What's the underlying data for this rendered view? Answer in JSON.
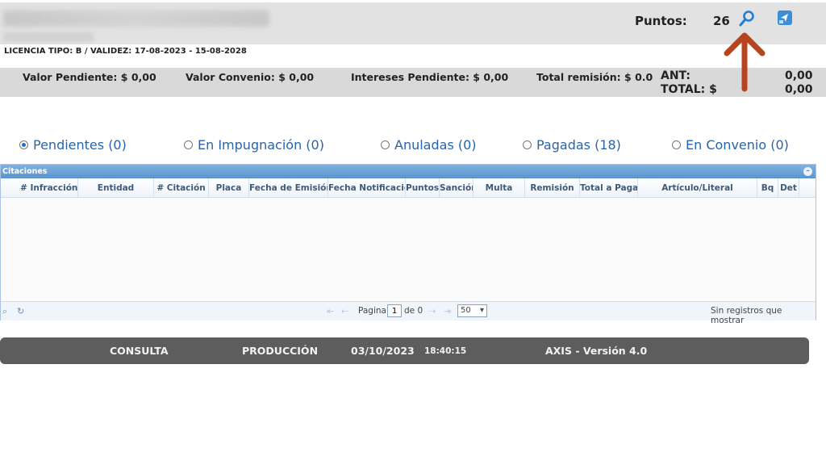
{
  "header": {
    "puntos_label": "Puntos:",
    "puntos_value": "26",
    "licencia": "LICENCIA TIPO: B   / VALIDEZ: 17-08-2023 - 15-08-2028"
  },
  "totals": {
    "valor_pendiente": "Valor Pendiente: $  0,00",
    "valor_convenio": "Valor Convenio: $  0,00",
    "intereses_pendiente": "Intereses Pendiente: $  0,00",
    "total_remision": "Total remisión: $ 0.0",
    "ant_label": "ANT:",
    "ant_value": "0,00",
    "total_label": "TOTAL: $",
    "total_value": "0,00"
  },
  "filters": [
    {
      "label": "Pendientes (0)",
      "checked": true
    },
    {
      "label": "En Impugnación (0)",
      "checked": false
    },
    {
      "label": "Anuladas (0)",
      "checked": false
    },
    {
      "label": "Pagadas (18)",
      "checked": false
    },
    {
      "label": "En Convenio (0)",
      "checked": false
    }
  ],
  "grid": {
    "title": "Citaciones",
    "columns": [
      "# Infracción",
      "Entidad",
      "# Citación",
      "Placa",
      "Fecha de Emisión",
      "Fecha Notificación",
      "Puntos",
      "Sanción",
      "Multa",
      "Remisión",
      "Total a Pagar",
      "Artículo/Literal",
      "Bq",
      "Det"
    ],
    "pager": {
      "page_label": "Pagina",
      "page_value": "1",
      "of_label": "de 0",
      "page_size": "50",
      "empty_text": "Sin registros que mostrar"
    }
  },
  "footer": {
    "consulta": "CONSULTA",
    "produccion": "PRODUCCIÓN",
    "date": "03/10/2023",
    "time": "18:40:15",
    "version": "AXIS - Versión 4.0"
  },
  "colors": {
    "accent": "#2a64a8",
    "grid_header": "#5b95cf",
    "arrow": "#b5441f",
    "footer": "#5d5d5d"
  },
  "icons": [
    "search-icon",
    "navigate-icon",
    "collapse-icon",
    "refresh-icon",
    "arrow-annotation-icon"
  ]
}
